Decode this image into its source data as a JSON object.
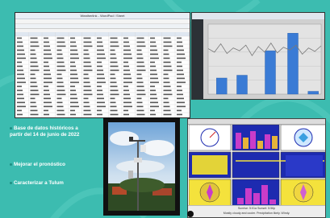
{
  "slide": {
    "bullets": [
      "Base de datos históricos a  partir del 14 de junio de 2022",
      "Mejorar el pronóstico",
      "Caracterizar a Tulum"
    ]
  },
  "spreadsheet": {
    "title": "Weatherlink - WordPad / Sheet"
  },
  "chart": {
    "bars": [
      0.23,
      0.27,
      0.62,
      0.87,
      0.04
    ],
    "line": [
      0.65,
      0.6,
      0.72,
      0.58,
      0.66,
      0.62,
      0.7,
      0.55,
      0.68,
      0.6,
      0.73,
      0.59,
      0.67,
      0.63,
      0.7,
      0.57,
      0.66,
      0.61,
      0.69
    ]
  },
  "dashboard": {
    "footer_line1": "Sunrise: 5:01a          Sunset: 5:56p",
    "footer_line2": "Mostly cloudy and cooler. Precipitation likely. Windy."
  },
  "colors": {
    "background": "#3cbcb0",
    "bar": "#3a7bd5",
    "bullet_dot": "#1f8d82"
  }
}
